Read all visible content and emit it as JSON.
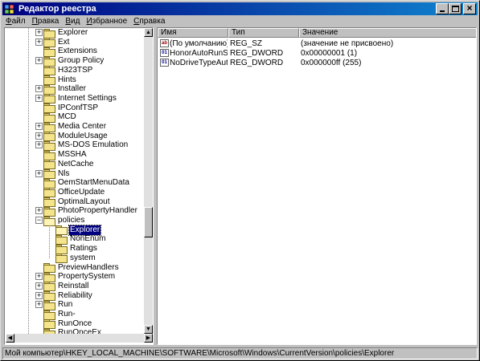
{
  "window": {
    "title": "Редактор реестра"
  },
  "menu": [
    "Файл",
    "Правка",
    "Вид",
    "Избранное",
    "Справка"
  ],
  "tree": [
    {
      "label": "Explorer",
      "expander": "+"
    },
    {
      "label": "Ext",
      "expander": "+"
    },
    {
      "label": "Extensions",
      "expander": ""
    },
    {
      "label": "Group Policy",
      "expander": "+"
    },
    {
      "label": "H323TSP",
      "expander": ""
    },
    {
      "label": "Hints",
      "expander": ""
    },
    {
      "label": "Installer",
      "expander": "+"
    },
    {
      "label": "Internet Settings",
      "expander": "+"
    },
    {
      "label": "IPConfTSP",
      "expander": ""
    },
    {
      "label": "MCD",
      "expander": ""
    },
    {
      "label": "Media Center",
      "expander": "+"
    },
    {
      "label": "ModuleUsage",
      "expander": "+"
    },
    {
      "label": "MS-DOS Emulation",
      "expander": "+"
    },
    {
      "label": "MSSHA",
      "expander": ""
    },
    {
      "label": "NetCache",
      "expander": ""
    },
    {
      "label": "Nls",
      "expander": "+"
    },
    {
      "label": "OemStartMenuData",
      "expander": ""
    },
    {
      "label": "OfficeUpdate",
      "expander": ""
    },
    {
      "label": "OptimalLayout",
      "expander": ""
    },
    {
      "label": "PhotoPropertyHandler",
      "expander": "+"
    },
    {
      "label": "policies",
      "expander": "-",
      "open": true
    },
    {
      "label": "Explorer",
      "expander": "",
      "child": true,
      "selected": true,
      "open": true
    },
    {
      "label": "NonEnum",
      "expander": "",
      "child": true
    },
    {
      "label": "Ratings",
      "expander": "",
      "child": true
    },
    {
      "label": "system",
      "expander": "",
      "child": true
    },
    {
      "label": "PreviewHandlers",
      "expander": ""
    },
    {
      "label": "PropertySystem",
      "expander": "+"
    },
    {
      "label": "Reinstall",
      "expander": "+"
    },
    {
      "label": "Reliability",
      "expander": "+"
    },
    {
      "label": "Run",
      "expander": "+"
    },
    {
      "label": "Run-",
      "expander": ""
    },
    {
      "label": "RunOnce",
      "expander": ""
    },
    {
      "label": "RunOnceEx",
      "expander": ""
    }
  ],
  "columns": {
    "name": "Имя",
    "type": "Тип",
    "value": "Значение"
  },
  "values": [
    {
      "icon": "string-value-icon",
      "icon_text": "ab",
      "name": "(По умолчанию)",
      "type": "REG_SZ",
      "data": "(значение не присвоено)"
    },
    {
      "icon": "dword-value-icon",
      "icon_text": "01",
      "name": "HonorAutoRunSet...",
      "type": "REG_DWORD",
      "data": "0x00000001 (1)"
    },
    {
      "icon": "dword-value-icon",
      "icon_text": "01",
      "name": "NoDriveTypeAuto...",
      "type": "REG_DWORD",
      "data": "0x000000ff (255)"
    }
  ],
  "scroll": {
    "vertical_position": 0.66
  },
  "status": "Мой компьютер\\HKEY_LOCAL_MACHINE\\SOFTWARE\\Microsoft\\Windows\\CurrentVersion\\policies\\Explorer"
}
